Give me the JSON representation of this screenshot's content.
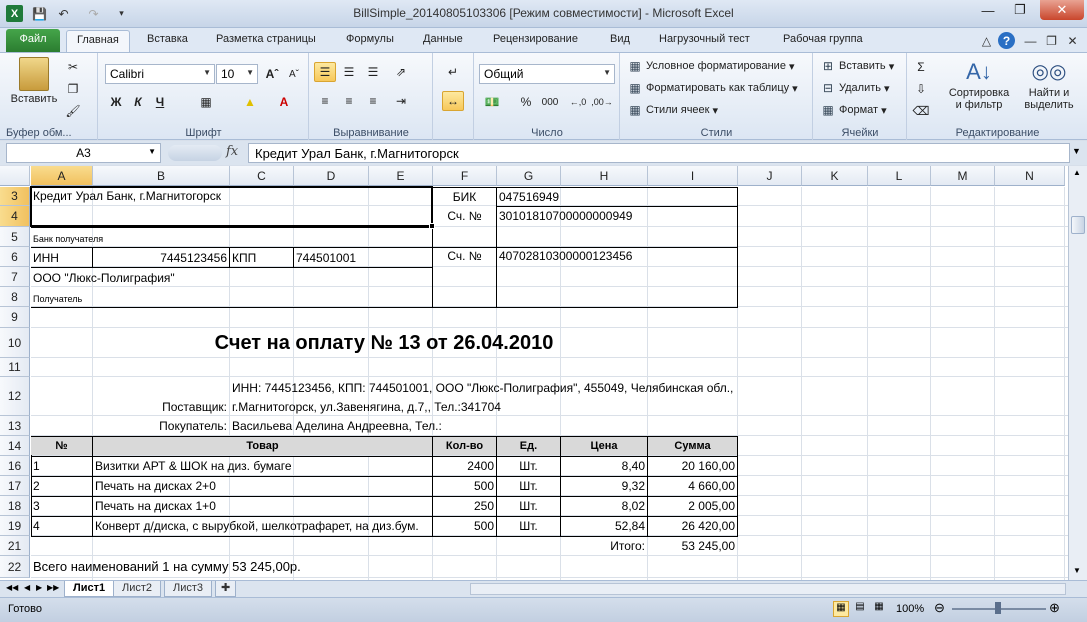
{
  "window": {
    "title": "BillSimple_20140805103306  [Режим совместимости]  -  Microsoft Excel"
  },
  "ribbon_tabs": [
    "Файл",
    "Главная",
    "Вставка",
    "Разметка страницы",
    "Формулы",
    "Данные",
    "Рецензирование",
    "Вид",
    "Нагрузочный тест",
    "Рабочая группа"
  ],
  "ribbon": {
    "paste": "Вставить",
    "clipboard_label": "Буфер обм...",
    "font_name": "Calibri",
    "font_size": "10",
    "font_label": "Шрифт",
    "align_label": "Выравнивание",
    "number_format": "Общий",
    "number_label": "Число",
    "cond_format": "Условное форматирование",
    "format_table": "Форматировать как таблицу",
    "cell_styles": "Стили ячеек",
    "styles_label": "Стили",
    "insert": "Вставить",
    "delete": "Удалить",
    "format": "Формат",
    "cells_label": "Ячейки",
    "sort_filter_1": "Сортировка",
    "sort_filter_2": "и фильтр",
    "find_1": "Найти и",
    "find_2": "выделить",
    "edit_label": "Редактирование",
    "percent": "%",
    "thousands": "000",
    "bold": "Ж",
    "italic": "К",
    "underline": "Ч"
  },
  "formula_bar": {
    "name_box": "A3",
    "fx": "fx",
    "formula": "Кредит Урал Банк, г.Магнитогорск"
  },
  "columns": [
    "A",
    "B",
    "C",
    "D",
    "E",
    "F",
    "G",
    "H",
    "I",
    "J",
    "K",
    "L",
    "M",
    "N"
  ],
  "rows": [
    "3",
    "4",
    "5",
    "6",
    "7",
    "8",
    "9",
    "10",
    "11",
    "12",
    "13",
    "14",
    "16",
    "17",
    "18",
    "19",
    "21",
    "22"
  ],
  "sheet": {
    "bank_name": "Кредит Урал Банк, г.Магнитогорск",
    "bank_label": "Банк получателя",
    "inn_label": "ИНН",
    "inn_value": "7445123456",
    "kpp_label": "КПП",
    "kpp_value": "744501001",
    "recipient_name": "ООО \"Люкс-Полиграфия\"",
    "recipient_label": "Получатель",
    "bik_label": "БИК",
    "bik_value": "047516949",
    "acc_label_1": "Сч. №",
    "acc_value_1": "30101810700000000949",
    "acc_label_2": "Сч. №",
    "acc_value_2": "40702810300000123456",
    "invoice_title": "Счет на оплату № 13 от 26.04.2010",
    "supplier_label": "Поставщик:",
    "supplier_line1": "ИНН: 7445123456, КПП: 744501001, ООО \"Люкс-Полиграфия\", 455049, Челябинская обл.,",
    "supplier_line2": "г.Магнитогорск, ул.Завенягина, д.7,, Тел.:341704",
    "buyer_label": "Покупатель:",
    "buyer_value": "Васильева Аделина Андреевна, Тел.:",
    "table_headers": [
      "№",
      "Товар",
      "Кол-во",
      "Ед.",
      "Цена",
      "Сумма"
    ],
    "items": [
      {
        "n": "1",
        "name": "Визитки  АРТ & ШОК  на диз. бумаге",
        "qty": "2400",
        "unit": "Шт.",
        "price": "8,40",
        "sum": "20 160,00"
      },
      {
        "n": "2",
        "name": "Печать на дисках 2+0",
        "qty": "500",
        "unit": "Шт.",
        "price": "9,32",
        "sum": "4 660,00"
      },
      {
        "n": "3",
        "name": "Печать на дисках 1+0",
        "qty": "250",
        "unit": "Шт.",
        "price": "8,02",
        "sum": "2 005,00"
      },
      {
        "n": "4",
        "name": "Конверт д/диска, с вырубкой, шелкотрафарет, на диз.бум.",
        "qty": "500",
        "unit": "Шт.",
        "price": "52,84",
        "sum": "26 420,00"
      }
    ],
    "total_label": "Итого:",
    "total_value": "53 245,00",
    "summary": "Всего наименований 1 на сумму 53 245,00р."
  },
  "sheet_tabs": [
    "Лист1",
    "Лист2",
    "Лист3"
  ],
  "status": {
    "ready": "Готово",
    "zoom": "100%"
  }
}
